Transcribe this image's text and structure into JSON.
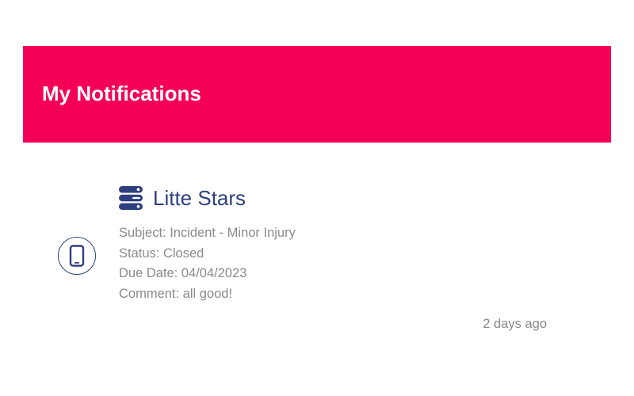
{
  "header": {
    "title": "My Notifications",
    "color": "#f50057"
  },
  "notification": {
    "device_icon": "mobile-phone-icon",
    "org_icon": "server-stack-icon",
    "org_name": "Litte Stars",
    "subject": "Subject: Incident - Minor Injury",
    "status": "Status: Closed",
    "due_date": "Due Date: 04/04/2023",
    "comment": "Comment: all good!",
    "time_ago": "2 days ago",
    "accent_color": "#2e3f7f"
  }
}
